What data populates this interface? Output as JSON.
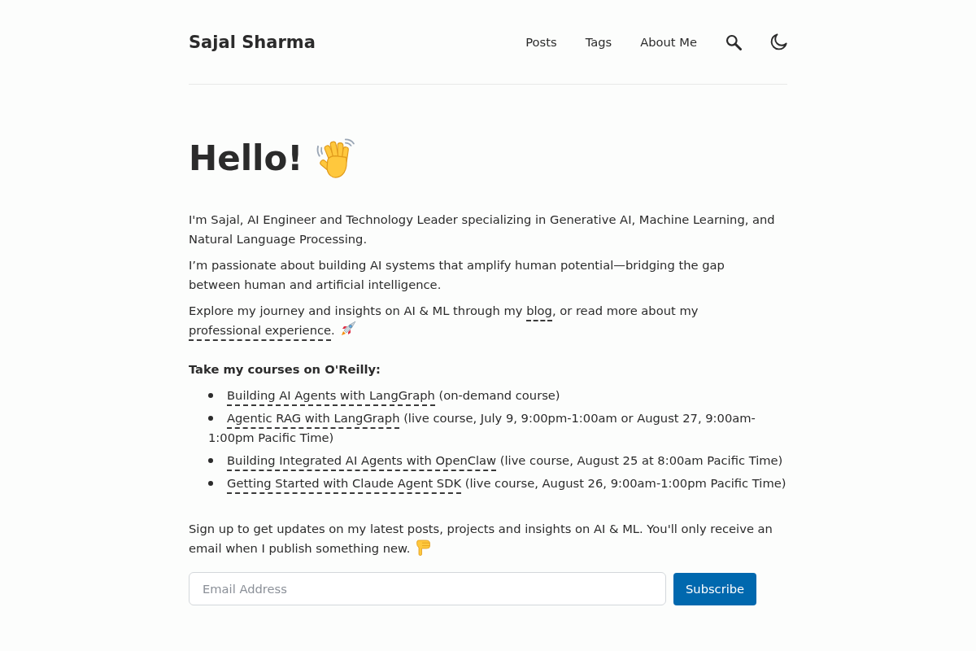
{
  "header": {
    "site_title": "Sajal Sharma",
    "nav_links": [
      {
        "label": "Posts"
      },
      {
        "label": "Tags"
      },
      {
        "label": "About Me"
      }
    ]
  },
  "intro": {
    "heading": "Hello!",
    "paragraphs": [
      {
        "parts": [
          {
            "kind": "text",
            "text": "I'm Sajal, AI Engineer and Technology Leader specializing in Generative AI, Machine Learning, and Natural Language Processing."
          }
        ]
      },
      {
        "parts": [
          {
            "kind": "text",
            "text": "I’m passionate about building AI systems that amplify human potential—bridging the gap between human and artificial intelligence."
          }
        ]
      },
      {
        "parts": [
          {
            "kind": "text",
            "text": "Explore my journey and insights on AI & ML through my "
          },
          {
            "kind": "link",
            "text": "blog"
          },
          {
            "kind": "text",
            "text": ", or read more about my "
          },
          {
            "kind": "link",
            "text": "professional experience"
          },
          {
            "kind": "text",
            "text": "."
          }
        ]
      }
    ]
  },
  "courses": {
    "heading": "Take my courses on O'Reilly:",
    "items": [
      {
        "title": "Building AI Agents with LangGraph",
        "details": "(on-demand course)"
      },
      {
        "title": "Agentic RAG with LangGraph",
        "details": "(live course, July 9, 9:00pm-1:00am or August 27, 9:00am-1:00pm Pacific Time)"
      },
      {
        "title": "Building Integrated AI Agents with OpenClaw",
        "details": "(live course, August 25 at 8:00am Pacific Time)"
      },
      {
        "title": "Getting Started with Claude Agent SDK",
        "details": "(live course, August 26, 9:00am-1:00pm Pacific Time)"
      }
    ]
  },
  "signup": {
    "text": "Sign up to get updates on my latest posts, projects and insights on AI & ML. You'll only receive an email when I publish something new.",
    "email_field": {
      "placeholder": "Email Address"
    },
    "subscribe_button": "Subscribe"
  }
}
